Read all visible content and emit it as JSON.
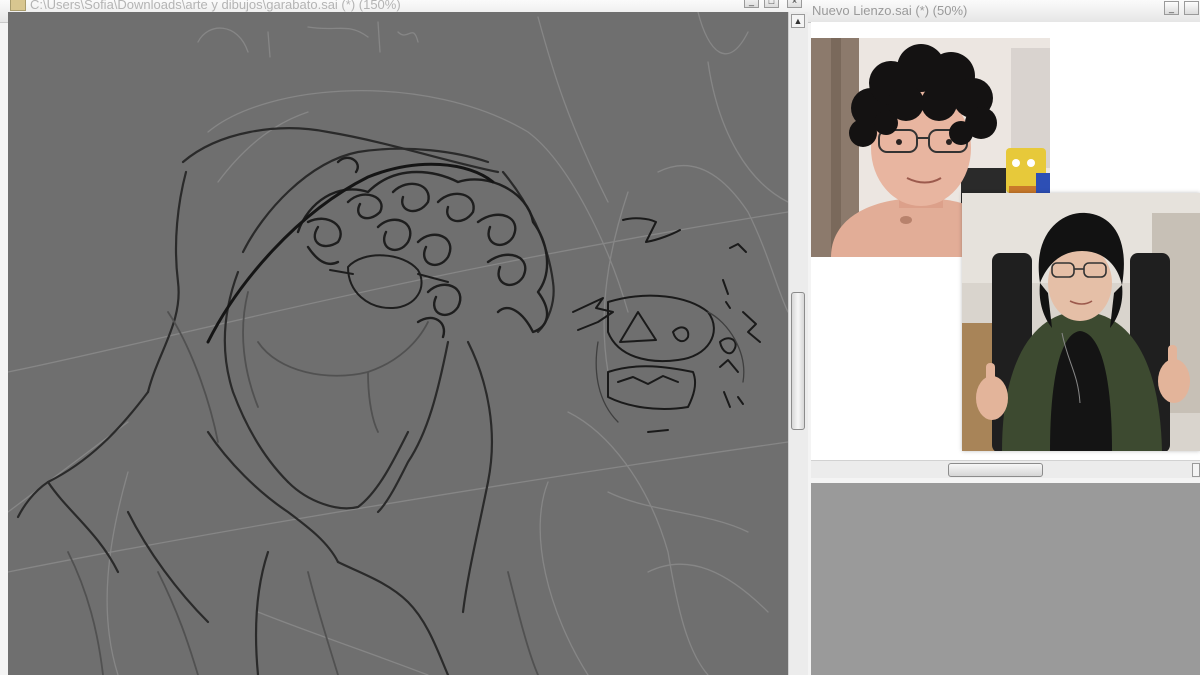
{
  "left_window": {
    "title": "C:\\Users\\Sofia\\Downloads\\arte y dibujos\\garabato.sai (*) (150%)",
    "min_glyph": "_",
    "max_glyph": "□",
    "close_glyph": "×",
    "scroll_up_glyph": "▲"
  },
  "right_window": {
    "title": "Nuevo Lienzo.sai (*) (50%)",
    "min_glyph": "_",
    "scroll_right_glyph": "▸"
  },
  "colors": {
    "canvas_bg": "#6f6f6f",
    "window_chrome": "#f4f4f4",
    "empty_workspace": "#9a9a9a"
  },
  "images": [
    {
      "name": "webcam-photo-curly-hair",
      "kind": "photo"
    },
    {
      "name": "webcam-photo-thumbs-up",
      "kind": "photo"
    }
  ]
}
